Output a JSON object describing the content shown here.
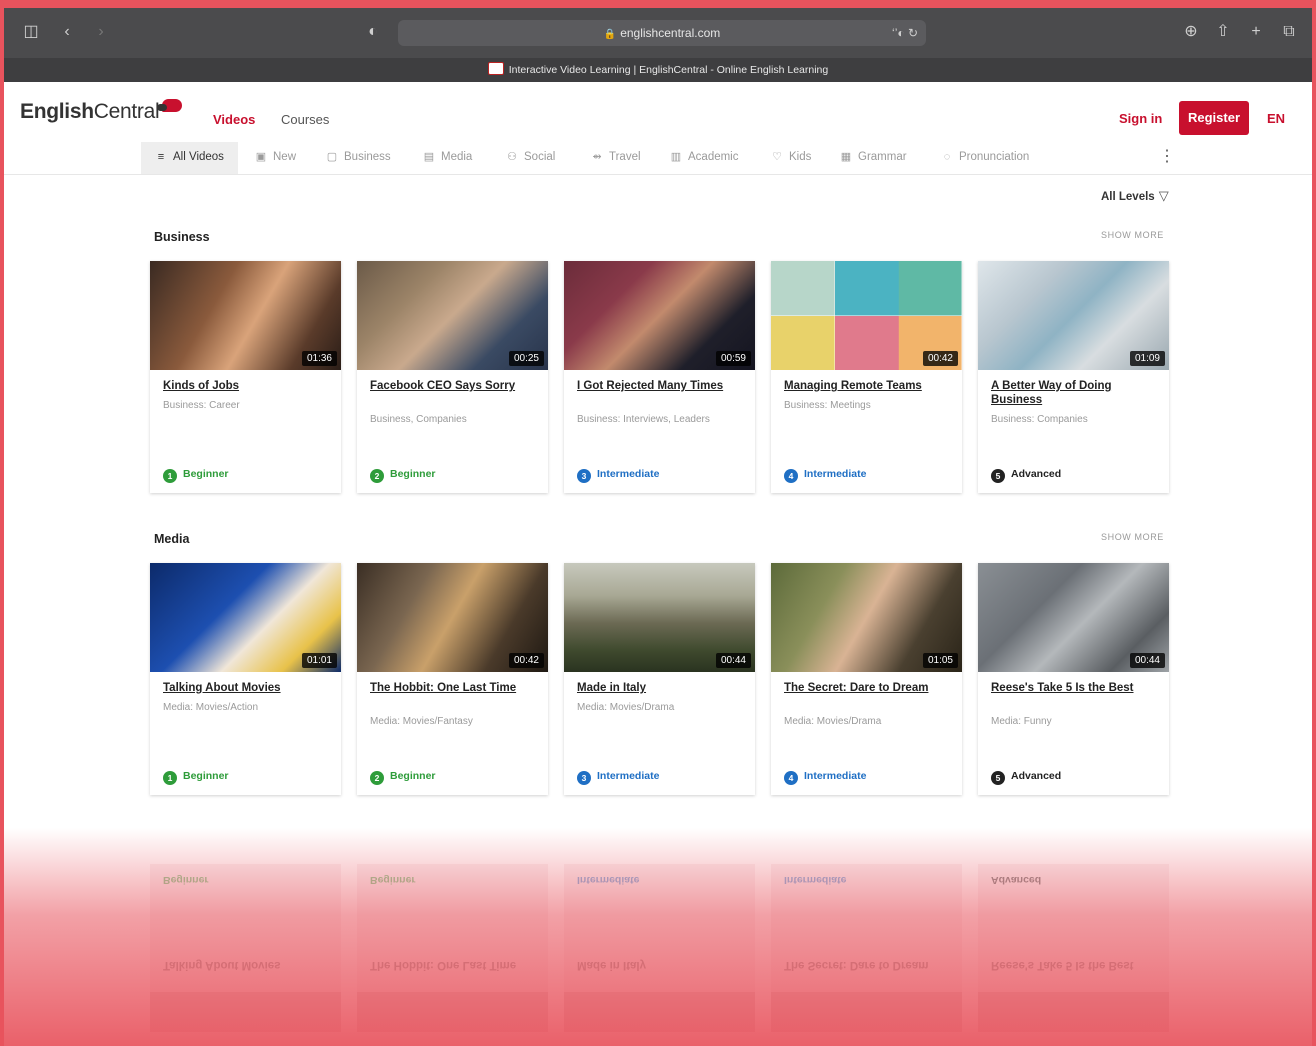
{
  "browser": {
    "url": "englishcentral.com",
    "tab_title": "Interactive Video Learning | EnglishCentral - Online English Learning",
    "address_right": "‘’◐ ↻"
  },
  "header": {
    "logo_bold": "English",
    "logo_light": "Central",
    "nav": {
      "videos": "Videos",
      "courses": "Courses"
    },
    "sign_in": "Sign in",
    "register": "Register",
    "language": "EN"
  },
  "categories": [
    {
      "label": "All Videos",
      "icon": "menu-icon",
      "glyph": "≡"
    },
    {
      "label": "New",
      "icon": "calendar-icon",
      "glyph": "▣"
    },
    {
      "label": "Business",
      "icon": "briefcase-icon",
      "glyph": "▢"
    },
    {
      "label": "Media",
      "icon": "film-icon",
      "glyph": "▤"
    },
    {
      "label": "Social",
      "icon": "people-icon",
      "glyph": "⚇"
    },
    {
      "label": "Travel",
      "icon": "signpost-icon",
      "glyph": "⇴"
    },
    {
      "label": "Academic",
      "icon": "book-icon",
      "glyph": "▥"
    },
    {
      "label": "Kids",
      "icon": "balloon-icon",
      "glyph": "♡"
    },
    {
      "label": "Grammar",
      "icon": "grammar-icon",
      "glyph": "▦"
    },
    {
      "label": "Pronunciation",
      "icon": "speech-icon",
      "glyph": "◌"
    }
  ],
  "filter": {
    "label": "All Levels",
    "icon": "filter-icon"
  },
  "sections": [
    {
      "title": "Business",
      "show_more": "SHOW MORE",
      "cards": [
        {
          "title": "Kinds of Jobs",
          "tags": "Business: Career",
          "duration": "01:36",
          "level": "Beginner",
          "level_num": "1"
        },
        {
          "title": "Facebook CEO Says Sorry",
          "tags": "Business, Companies",
          "duration": "00:25",
          "level": "Beginner",
          "level_num": "2"
        },
        {
          "title": "I Got Rejected Many Times",
          "tags": "Business: Interviews, Leaders",
          "duration": "00:59",
          "level": "Intermediate",
          "level_num": "3"
        },
        {
          "title": "Managing Remote Teams",
          "tags": "Business: Meetings",
          "duration": "00:42",
          "level": "Intermediate",
          "level_num": "4"
        },
        {
          "title": "A Better Way of Doing Business",
          "tags": "Business: Companies",
          "duration": "01:09",
          "level": "Advanced",
          "level_num": "5"
        }
      ]
    },
    {
      "title": "Media",
      "show_more": "SHOW MORE",
      "cards": [
        {
          "title": "Talking About Movies",
          "tags": "Media: Movies/Action",
          "duration": "01:01",
          "level": "Beginner",
          "level_num": "1"
        },
        {
          "title": "The Hobbit: One Last Time",
          "tags": "Media: Movies/Fantasy",
          "duration": "00:42",
          "level": "Beginner",
          "level_num": "2"
        },
        {
          "title": "Made in Italy",
          "tags": "Media: Movies/Drama",
          "duration": "00:44",
          "level": "Intermediate",
          "level_num": "3"
        },
        {
          "title": "The Secret: Dare to Dream",
          "tags": "Media: Movies/Drama",
          "duration": "01:05",
          "level": "Intermediate",
          "level_num": "4"
        },
        {
          "title": "Reese's Take 5 Is the Best",
          "tags": "Media: Funny",
          "duration": "00:44",
          "level": "Advanced",
          "level_num": "5"
        }
      ]
    }
  ],
  "colors": {
    "brand": "#c8102e",
    "beginner": "#2e9c3a",
    "intermediate": "#1f6fc4",
    "advanced": "#222222",
    "background": "#e8535d"
  }
}
